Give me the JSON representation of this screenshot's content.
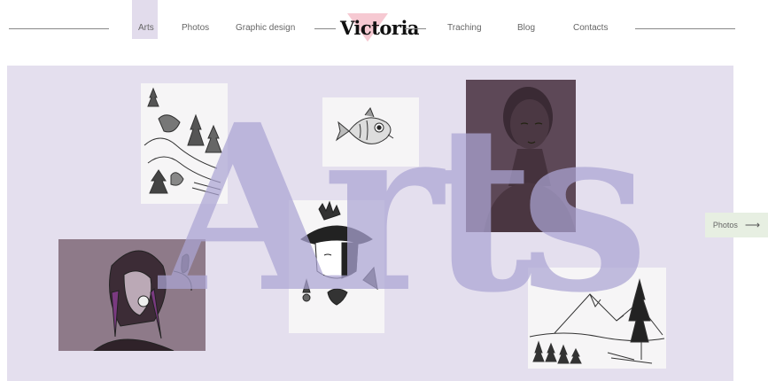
{
  "header": {
    "logo": "Victoria",
    "nav_left": [
      "Arts",
      "Photos",
      "Graphic design"
    ],
    "nav_right": [
      "Traching",
      "Blog",
      "Contacts"
    ],
    "active_item": "Arts",
    "accent_color": "#e2dcec",
    "logo_mark_color": "#f6c9d2"
  },
  "hero": {
    "title": "Arts",
    "background_color": "#e4dfee",
    "title_color": "#aca5d4",
    "artworks": [
      "landscape-sketch",
      "fish-drawing",
      "woman-portrait",
      "feathered-portrait",
      "hatted-figure-sketch",
      "mountain-forest-sketch"
    ],
    "next_button": {
      "label": "Photos",
      "icon": "arrow-right-icon",
      "color": "#e7efe2"
    }
  }
}
